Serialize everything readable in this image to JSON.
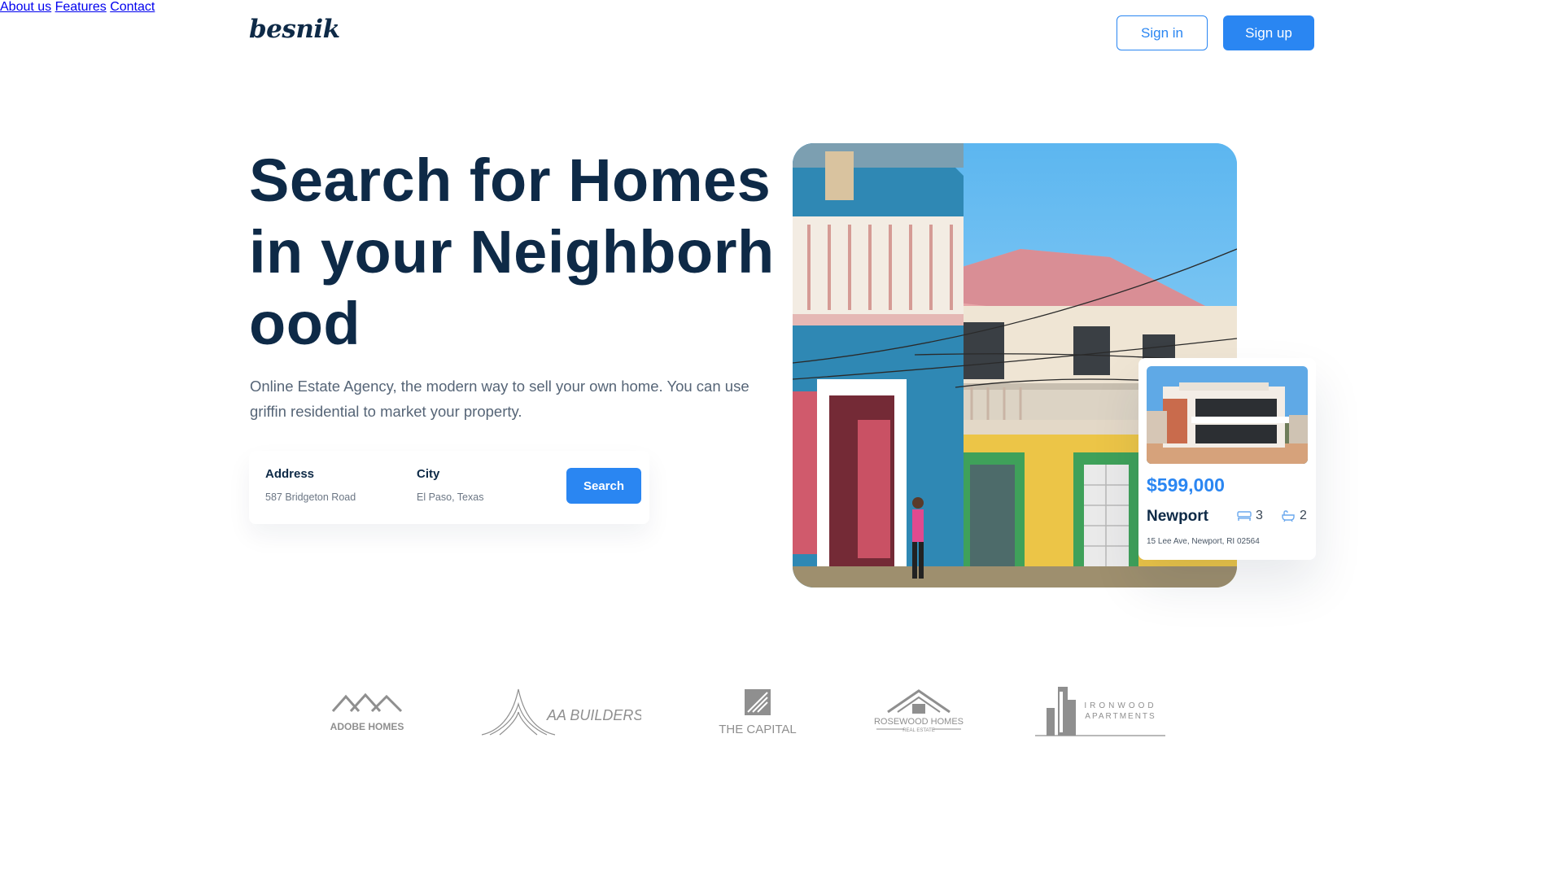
{
  "brand": {
    "logo": "besnik"
  },
  "nav": {
    "links": [
      {
        "label": "About us"
      },
      {
        "label": "Features"
      },
      {
        "label": "Contact"
      }
    ],
    "signin_label": "Sign in",
    "signup_label": "Sign up"
  },
  "hero": {
    "title_lines": [
      "Search for Homes",
      "in your Neighborh",
      "ood"
    ],
    "subtitle": "Online Estate Agency, the modern way to sell your own home. You can use griffin residential to market your property."
  },
  "search": {
    "address_label": "Address",
    "address_value": "587 Bridgeton Road",
    "city_label": "City",
    "city_value": "El Paso, Texas",
    "button_label": "Search"
  },
  "property": {
    "price": "$599,000",
    "name": "Newport",
    "beds": "3",
    "baths": "2",
    "address": "15 Lee Ave, Newport, RI 02564"
  },
  "partners": [
    {
      "name": "ADOBE HOMES"
    },
    {
      "name": "AA BUILDERS"
    },
    {
      "name": "THE CAPITAL"
    },
    {
      "name": "ROSEWOOD HOMES",
      "tagline": "REAL ESTATE"
    },
    {
      "name": "IRONWOOD",
      "tagline": "APARTMENTS"
    }
  ],
  "colors": {
    "primary": "#2a86f2",
    "heading": "#0e2a47",
    "body_text": "#566577",
    "logo_gray": "#8f8f8f"
  }
}
